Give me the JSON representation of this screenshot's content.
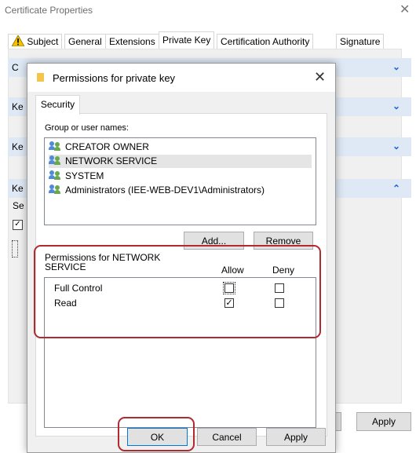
{
  "background_window": {
    "title": "Certificate Properties",
    "close_glyph": "✕",
    "tabs": [
      "Subject",
      "General",
      "Extensions",
      "Private Key",
      "Certification Authority",
      "Signature"
    ],
    "active_tab": "Private Key",
    "row1_label": "C",
    "row2_label": "Ke",
    "row3_label": "Ke",
    "row4_label": "Ke",
    "side_text": "Se",
    "apply_label": "Apply"
  },
  "dialog": {
    "title": "Permissions for private key",
    "close_glyph": "✕",
    "tab_security": "Security",
    "group_label": "Group or user names:",
    "users": [
      {
        "name": "CREATOR OWNER",
        "selected": false
      },
      {
        "name": "NETWORK SERVICE",
        "selected": true
      },
      {
        "name": "SYSTEM",
        "selected": false
      },
      {
        "name": "Administrators (IEE-WEB-DEV1\\Administrators)",
        "selected": false
      }
    ],
    "add_label": "Add...",
    "remove_label": "Remove",
    "permissions_label_line1": "Permissions for NETWORK",
    "permissions_label_line2": "SERVICE",
    "allow_header": "Allow",
    "deny_header": "Deny",
    "permissions": [
      {
        "name": "Full Control",
        "allow": false,
        "deny": false
      },
      {
        "name": "Read",
        "allow": true,
        "deny": false
      }
    ],
    "ok_label": "OK",
    "cancel_label": "Cancel",
    "apply_label": "Apply"
  },
  "colors": {
    "highlight": "#b02a30",
    "accent_blue": "#0078d7",
    "expander_bg": "#dfe9f5"
  }
}
